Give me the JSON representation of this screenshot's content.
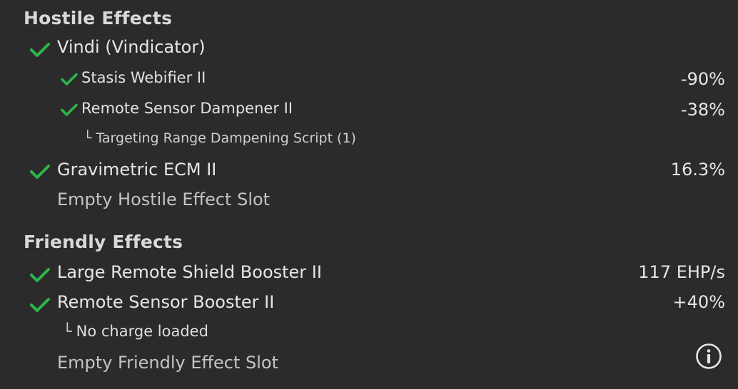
{
  "hostile": {
    "title": "Hostile Effects",
    "source": {
      "name": "Vindi (Vindicator)",
      "checked": true
    },
    "modules": [
      {
        "name": "Stasis Webifier II",
        "value": "-90%",
        "checked": true
      },
      {
        "name": "Remote Sensor Dampener II",
        "value": "-38%",
        "checked": true,
        "charge": "Targeting Range Dampening Script (1)"
      }
    ],
    "ecm": {
      "name": "Gravimetric ECM II",
      "value": "16.3%",
      "checked": true
    },
    "empty_slot": "Empty Hostile Effect Slot"
  },
  "friendly": {
    "title": "Friendly Effects",
    "modules": [
      {
        "name": "Large Remote Shield Booster II",
        "value": "117 EHP/s",
        "checked": true
      },
      {
        "name": "Remote Sensor Booster II",
        "value": "+40%",
        "checked": true,
        "charge": "No charge loaded"
      }
    ],
    "empty_slot": "Empty Friendly Effect Slot"
  },
  "branch_glyph": "└",
  "icons": {
    "check": "checkmark-icon",
    "info": "info-icon"
  },
  "colors": {
    "background": "#2b2b2b",
    "check": "#2fb54a",
    "text": "#e6e6e6"
  }
}
